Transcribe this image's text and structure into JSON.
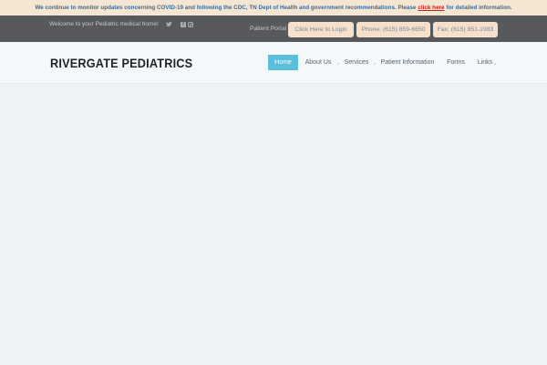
{
  "alert": {
    "text_before": "We continue to monitor updates concerning COVID-19 and following the CDC, TN Dept of Health and government recommendations. Please",
    "link_text": "click here",
    "text_after": "for detailed information."
  },
  "topbar": {
    "welcome": "Welcome to your Pediatric medical home!",
    "portal_label": "Patient Portal",
    "login_button": "Click Here to Login",
    "phone_button": "Phone: (615) 859-6650",
    "fax_button": "Fax: (615) 851-1983"
  },
  "social": [
    "twitter-icon",
    "facebook-icon",
    "instagram-icon"
  ],
  "header": {
    "logo": "RIVERGATE PEDIATRICS"
  },
  "nav": {
    "items": [
      {
        "label": "Home",
        "active": true
      },
      {
        "label": "About Us",
        "active": false
      },
      {
        "label": "Services",
        "active": false
      },
      {
        "label": "Patient Information",
        "active": false
      },
      {
        "label": "Forms",
        "active": false
      },
      {
        "label": "Links",
        "active": false
      }
    ]
  },
  "colors": {
    "alert_bg": "#f4e6d2",
    "alert_text": "#3a6d97",
    "alert_link": "#d01818",
    "topbar_bg": "#57595d",
    "pill_bg": "#f6e0cb",
    "nav_active": "#5cbfd9",
    "page_bg": "#eef2f5"
  }
}
